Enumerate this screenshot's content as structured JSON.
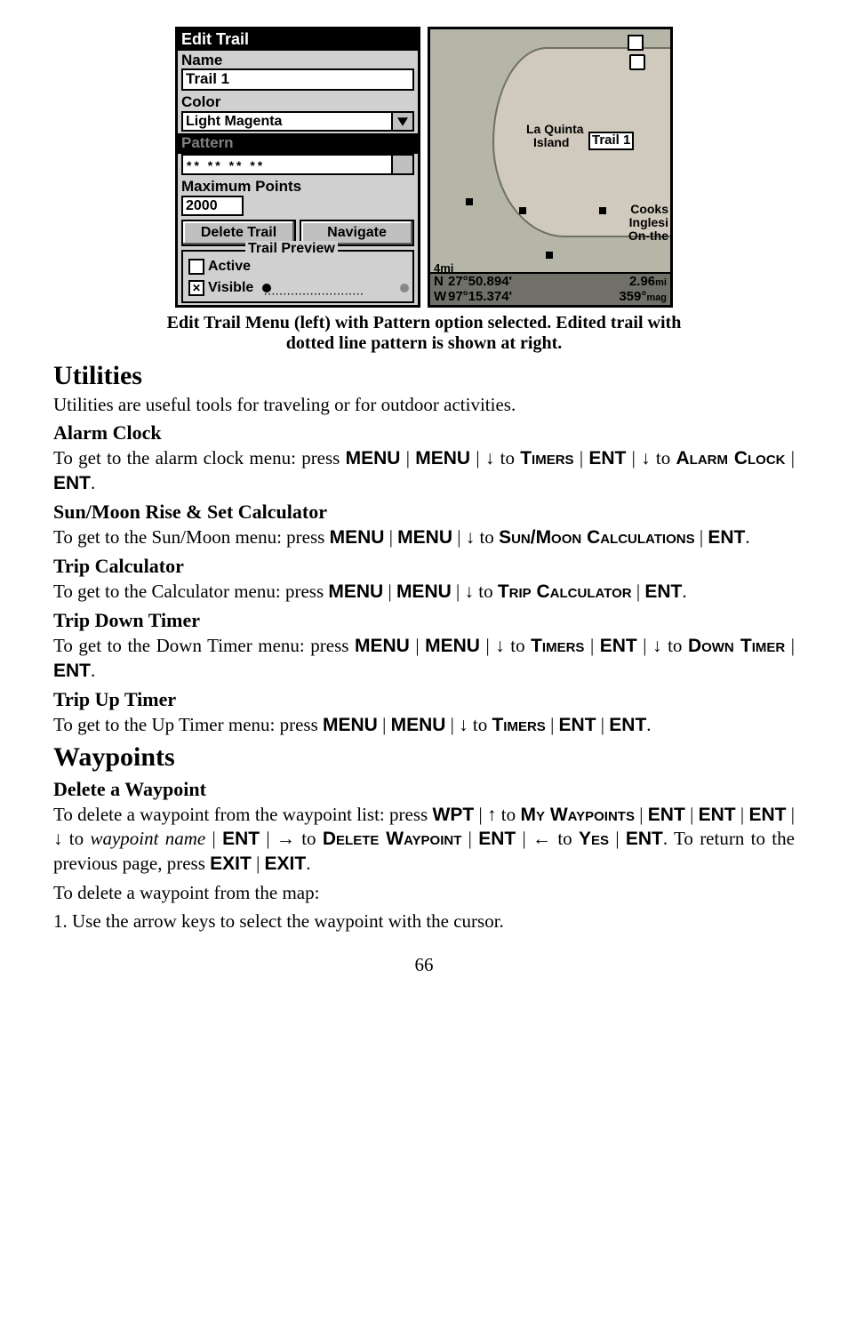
{
  "figure": {
    "left": {
      "title": "Edit Trail",
      "name_label": "Name",
      "name_value": "Trail 1",
      "color_label": "Color",
      "color_value": "Light Magenta",
      "pattern_label": "Pattern",
      "pattern_dots": "**   **   **   **",
      "max_label": "Maximum Points",
      "max_value": "2000",
      "btn_delete": "Delete Trail",
      "btn_navigate": "Navigate",
      "preview_title": "Trail Preview",
      "active_label": "Active",
      "visible_label": "Visible",
      "visible_check": "✕"
    },
    "right": {
      "la_quinta": "La Quinta",
      "island": "Island",
      "trail_label": "Trail 1",
      "cooks": "Cooks",
      "inglesi": "Inglesi",
      "onthe": "On-the",
      "scale": "4mi",
      "nw": "N\nW",
      "lat": "27°50.894'",
      "lon": "97°15.374'",
      "dist": "2.96",
      "dist_unit": "mi",
      "heading": "359°",
      "heading_unit": "mag"
    },
    "caption_line1": "Edit Trail Menu (left) with Pattern option selected. Edited trail with",
    "caption_line2": "dotted line pattern is shown at right."
  },
  "sections": {
    "utilities_h": "Utilities",
    "utilities_intro": "Utilities are useful tools for traveling or for outdoor activities.",
    "alarm_h": "Alarm Clock",
    "alarm_p_a": "To get to the alarm clock menu: press ",
    "alarm_p_b": " to ",
    "sunmoon_h": "Sun/Moon Rise & Set Calculator",
    "sunmoon_p_a": "To get to the Sun/Moon menu: press ",
    "tripcalc_h": "Trip Calculator",
    "tripcalc_p_a": "To get to the Calculator menu: press ",
    "tripdown_h": "Trip Down Timer",
    "tripdown_p_a": "To get to the Down Timer menu: press ",
    "tripup_h": "Trip Up Timer",
    "tripup_p_a": "To get to the Up Timer menu: press ",
    "waypoints_h": "Waypoints",
    "delwp_h": "Delete a Waypoint",
    "delwp_p_a": "To delete a waypoint from the waypoint list: press ",
    "delwp_p_b": ". To return to the previous page, press ",
    "delmap_p": "To delete a waypoint from the map:",
    "delmap_1": "1. Use the arrow keys to select the waypoint with the cursor."
  },
  "keys": {
    "MENU": "MENU",
    "ENT": "ENT",
    "WPT": "WPT",
    "EXIT": "EXIT",
    "TIMERS": "Timers",
    "ALARM_CLOCK": "Alarm Clock",
    "SUNMOON": "Sun/Moon Calculations",
    "TRIPCALC": "Trip Calculator",
    "DOWNTIMER": "Down Timer",
    "MYWAYPOINTS": "My Waypoints",
    "DELETEWP": "Delete Waypoint",
    "YES": "Yes",
    "to": " to ",
    "wpname": "waypoint name",
    "pipe": " | ",
    "down": "↓",
    "up": "↑",
    "right": "→",
    "left": "←",
    "period": "."
  },
  "pageno": "66"
}
